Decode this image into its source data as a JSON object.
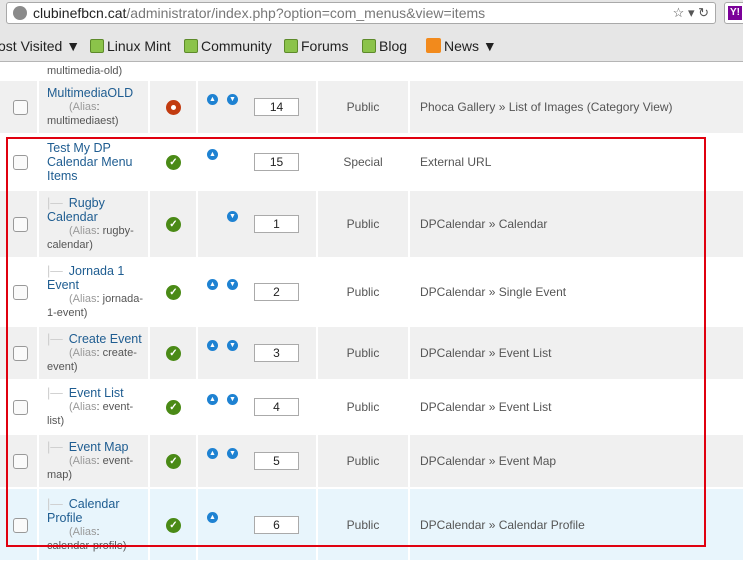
{
  "browser": {
    "url_host": "clubinefbcn.cat",
    "url_path": "/administrator/index.php?option=com_menus&view=items",
    "bookmarks": [
      {
        "label": "ost Visited ▼",
        "icon": "none"
      },
      {
        "label": "Linux Mint",
        "icon": "mint-icon"
      },
      {
        "label": "Community",
        "icon": "mint-icon"
      },
      {
        "label": "Forums",
        "icon": "mint-icon"
      },
      {
        "label": "Blog",
        "icon": "mint-icon"
      },
      {
        "label": "News ▼",
        "icon": "rss-icon"
      }
    ]
  },
  "partial_row": {
    "alias_tail": "multimedia-old)"
  },
  "alias_label": "Alias",
  "rows": [
    {
      "title": "MultimediaOLD",
      "alias": "multimediaest",
      "child": false,
      "status": "unpublished",
      "up": true,
      "down": true,
      "order": "14",
      "access": "Public",
      "type": "Phoca Gallery » List of Images (Category View)",
      "bg": "gray"
    },
    {
      "title": "Test My DP Calendar Menu Items",
      "alias": "",
      "child": false,
      "status": "published",
      "up": true,
      "down": false,
      "order": "15",
      "access": "Special",
      "type": "External URL",
      "bg": "white"
    },
    {
      "title": "Rugby Calendar",
      "alias": "rugby-calendar",
      "child": true,
      "status": "published",
      "up": false,
      "down": true,
      "order": "1",
      "access": "Public",
      "type": "DPCalendar » Calendar",
      "bg": "gray"
    },
    {
      "title": "Jornada 1 Event",
      "alias": "jornada-1-event",
      "child": true,
      "status": "published",
      "up": true,
      "down": true,
      "order": "2",
      "access": "Public",
      "type": "DPCalendar » Single Event",
      "bg": "white"
    },
    {
      "title": "Create Event",
      "alias": "create-event",
      "child": true,
      "status": "published",
      "up": true,
      "down": true,
      "order": "3",
      "access": "Public",
      "type": "DPCalendar » Event List",
      "bg": "gray"
    },
    {
      "title": "Event List",
      "alias": "event-list",
      "child": true,
      "status": "published",
      "up": true,
      "down": true,
      "order": "4",
      "access": "Public",
      "type": "DPCalendar » Event List",
      "bg": "white"
    },
    {
      "title": "Event Map",
      "alias": "event-map",
      "child": true,
      "status": "published",
      "up": true,
      "down": true,
      "order": "5",
      "access": "Public",
      "type": "DPCalendar » Event Map",
      "bg": "gray"
    },
    {
      "title": "Calendar Profile",
      "alias": "calendar-profile",
      "child": true,
      "status": "published",
      "up": true,
      "down": false,
      "order": "6",
      "access": "Public",
      "type": "DPCalendar » Calendar Profile",
      "bg": "blue"
    }
  ],
  "colors": {
    "highlight_box": "#e0000f",
    "link": "#1f5d91",
    "published": "#4a8a16",
    "unpublished": "#c23b10",
    "arrow": "#1e82d2"
  }
}
